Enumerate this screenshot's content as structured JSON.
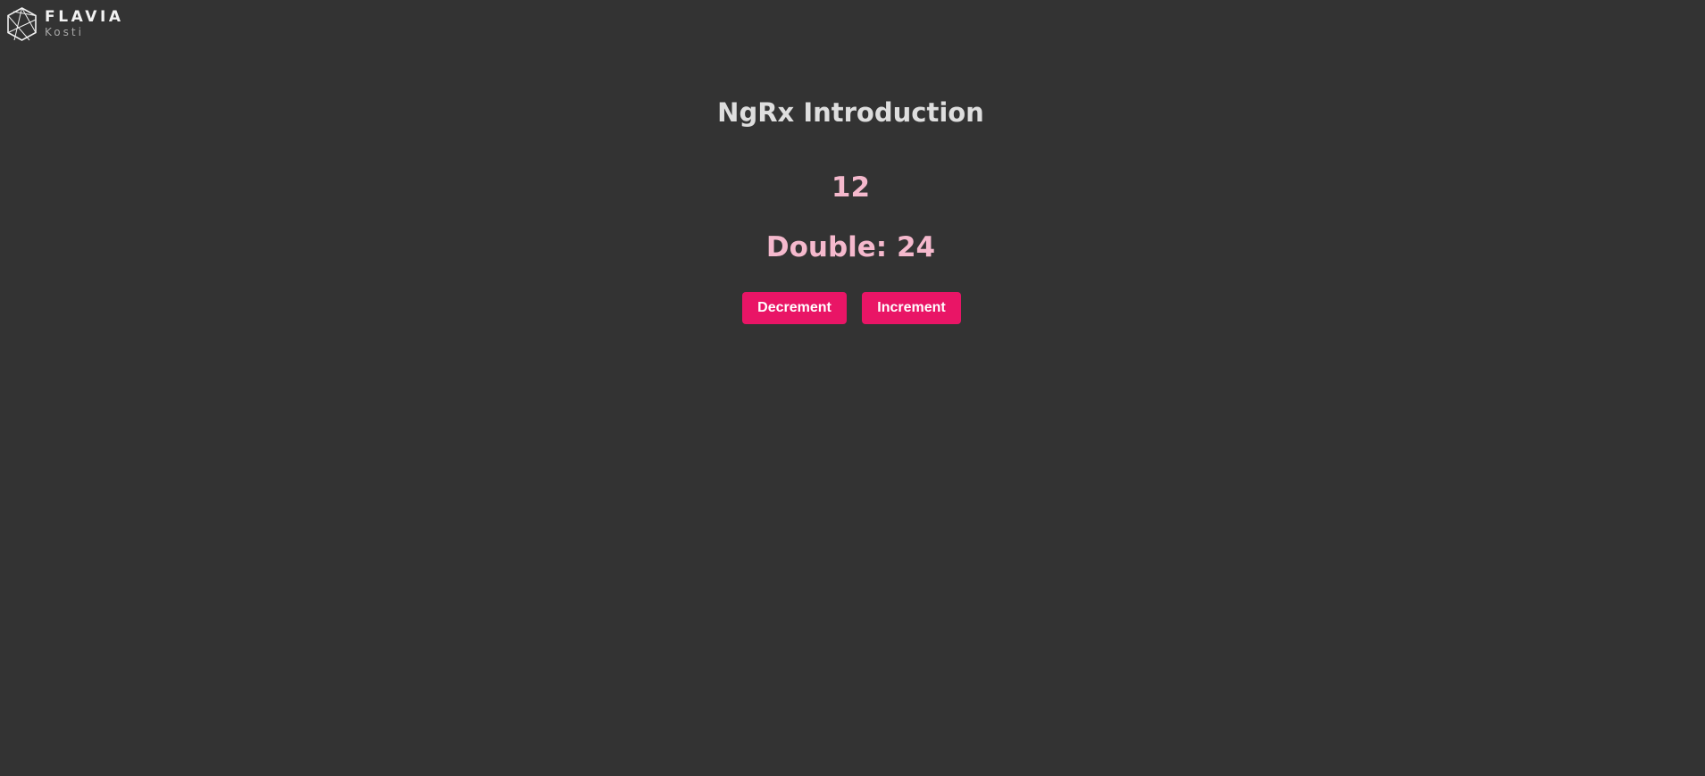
{
  "brand": {
    "name": "FLAVIA",
    "subtitle": "Kosti",
    "logo_icon": "geometric-gem-icon"
  },
  "page": {
    "title": "NgRx Introduction",
    "count": "12",
    "double_text": "Double: 24"
  },
  "counter": {
    "value": 12,
    "double": 24
  },
  "buttons": {
    "decrement_label": "Decrement",
    "increment_label": "Increment"
  },
  "colors": {
    "background": "#333333",
    "title": "#dedede",
    "count": "#f5b9cd",
    "button": "#e91566"
  }
}
